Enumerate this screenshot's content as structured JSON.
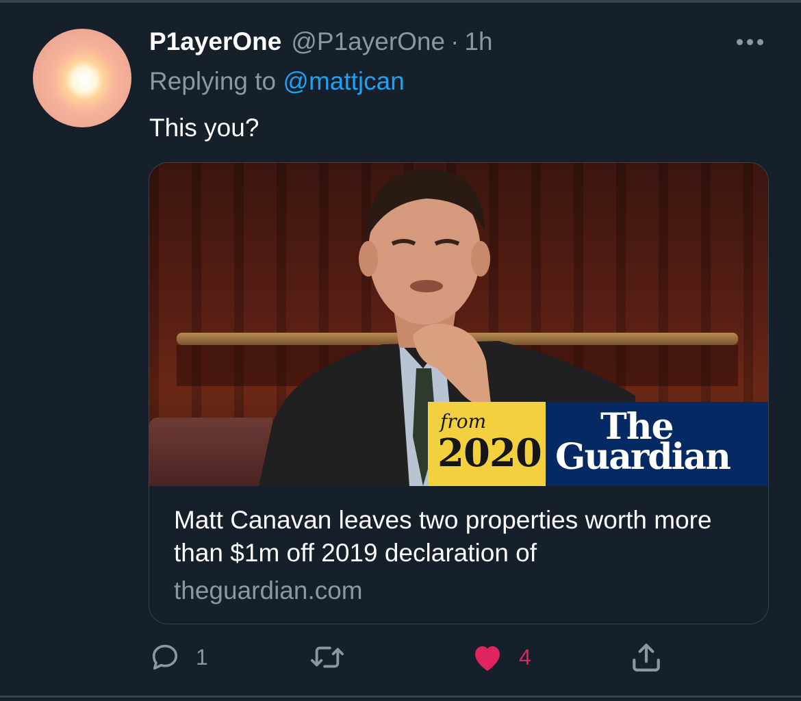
{
  "tweet": {
    "display_name": "P1ayerOne",
    "handle": "@P1ayerOne",
    "separator": "·",
    "time": "1h",
    "replying_to_label": "Replying to",
    "replying_to_handle": "@mattjcan",
    "text": "This you?"
  },
  "card": {
    "image_badge": {
      "from_label": "from",
      "year": "2020",
      "brand_line1": "The",
      "brand_line2": "Guardian"
    },
    "title": "Matt Canavan leaves two properties worth more than $1m off 2019 declaration of",
    "domain": "theguardian.com"
  },
  "actions": {
    "reply_count": "1",
    "like_count": "4"
  },
  "icons": [
    "more-icon",
    "reply-icon",
    "retweet-icon",
    "like-icon",
    "share-icon"
  ],
  "colors": {
    "background": "#15202b",
    "secondary_text": "#8899a6",
    "link": "#1da1f2",
    "like": "#e0245e",
    "border": "#38444d"
  }
}
